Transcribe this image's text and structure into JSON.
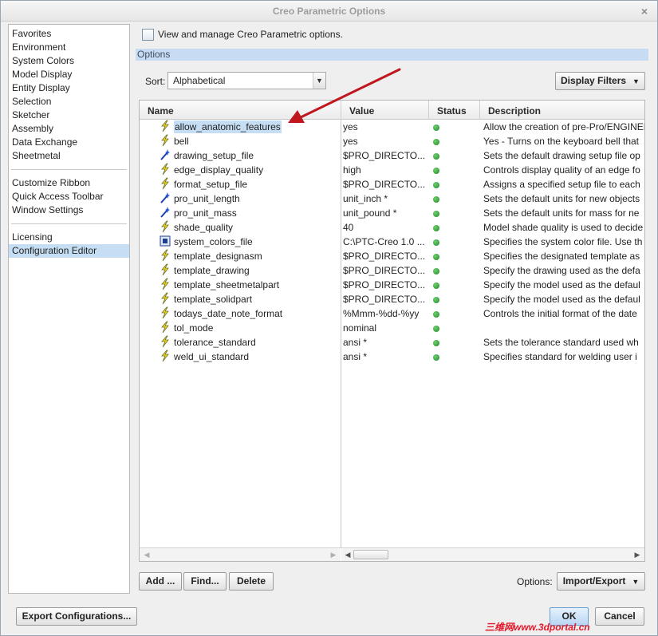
{
  "window": {
    "title": "Creo Parametric Options",
    "close_glyph": "×"
  },
  "nav": {
    "groups": [
      [
        "Favorites",
        "Environment",
        "System Colors",
        "Model Display",
        "Entity Display",
        "Selection",
        "Sketcher",
        "Assembly",
        "Data Exchange",
        "Sheetmetal"
      ],
      [
        "Customize Ribbon",
        "Quick Access Toolbar",
        "Window Settings"
      ],
      [
        "Licensing",
        "Configuration Editor"
      ]
    ],
    "selected": "Configuration Editor"
  },
  "header": {
    "intro": "View and manage Creo Parametric options.",
    "section": "Options"
  },
  "sort": {
    "label": "Sort:",
    "value": "Alphabetical"
  },
  "display_filters": {
    "label": "Display Filters"
  },
  "table": {
    "columns": {
      "name": "Name",
      "value": "Value",
      "status": "Status",
      "description": "Description"
    },
    "rows": [
      {
        "icon": "lightning-icon",
        "name": "allow_anatomic_features",
        "value": "yes",
        "desc": "Allow the creation of pre-Pro/ENGINEER",
        "selected": true
      },
      {
        "icon": "lightning-icon",
        "name": "bell",
        "value": "yes",
        "desc": "Yes - Turns on the keyboard bell that"
      },
      {
        "icon": "wand-icon",
        "name": "drawing_setup_file",
        "value": "$PRO_DIRECTO...",
        "desc": "Sets the default drawing setup file op"
      },
      {
        "icon": "lightning-icon",
        "name": "edge_display_quality",
        "value": "high",
        "desc": "Controls display quality of an edge fo"
      },
      {
        "icon": "lightning-icon",
        "name": "format_setup_file",
        "value": "$PRO_DIRECTO...",
        "desc": "Assigns a specified setup file to each"
      },
      {
        "icon": "wand-icon",
        "name": "pro_unit_length",
        "value": "unit_inch *",
        "desc": "Sets the default units for new objects"
      },
      {
        "icon": "wand-icon",
        "name": "pro_unit_mass",
        "value": "unit_pound *",
        "desc": "Sets the default units for mass for ne"
      },
      {
        "icon": "lightning-icon",
        "name": "shade_quality",
        "value": "40",
        "desc": "Model shade quality is used to decide"
      },
      {
        "icon": "system-icon",
        "name": "system_colors_file",
        "value": "C:\\PTC-Creo 1.0 ...",
        "desc": "Specifies the system color file. Use th"
      },
      {
        "icon": "lightning-icon",
        "name": "template_designasm",
        "value": "$PRO_DIRECTO...",
        "desc": "Specifies the designated template as"
      },
      {
        "icon": "lightning-icon",
        "name": "template_drawing",
        "value": "$PRO_DIRECTO...",
        "desc": "Specify the drawing used as the defa"
      },
      {
        "icon": "lightning-icon",
        "name": "template_sheetmetalpart",
        "value": "$PRO_DIRECTO...",
        "desc": "Specify the model used as the defaul"
      },
      {
        "icon": "lightning-icon",
        "name": "template_solidpart",
        "value": "$PRO_DIRECTO...",
        "desc": "Specify the model used as the defaul"
      },
      {
        "icon": "lightning-icon",
        "name": "todays_date_note_format",
        "value": "%Mmm-%dd-%yy",
        "desc": "Controls the initial format of the date"
      },
      {
        "icon": "lightning-icon",
        "name": "tol_mode",
        "value": "nominal",
        "desc": ""
      },
      {
        "icon": "lightning-icon",
        "name": "tolerance_standard",
        "value": "ansi *",
        "desc": "Sets the tolerance standard used wh"
      },
      {
        "icon": "lightning-icon",
        "name": "weld_ui_standard",
        "value": "ansi *",
        "desc": "Specifies standard for welding user i"
      }
    ]
  },
  "buttons": {
    "add": "Add ...",
    "find": "Find...",
    "delete": "Delete",
    "options_label": "Options:",
    "import_export": "Import/Export",
    "export_configurations": "Export Configurations...",
    "ok": "OK",
    "cancel": "Cancel"
  },
  "watermark": "三维网www.3dportal.cn",
  "colors": {
    "selection": "#c6def3",
    "status_ok": "#2ea043",
    "annotation_arrow": "#c0161e",
    "watermark": "#e0182a"
  }
}
